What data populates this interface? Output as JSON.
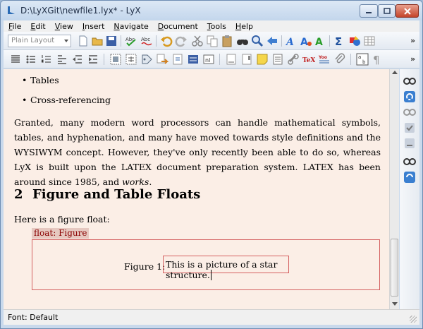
{
  "window": {
    "title": "D:\\LyXGit\\newfile1.lyx* - LyX"
  },
  "menu": [
    {
      "label": "File",
      "u": "F",
      "rest": "ile"
    },
    {
      "label": "Edit",
      "u": "E",
      "rest": "dit"
    },
    {
      "label": "View",
      "u": "V",
      "rest": "iew"
    },
    {
      "label": "Insert",
      "u": "I",
      "rest": "nsert"
    },
    {
      "label": "Navigate",
      "u": "N",
      "rest": "avigate"
    },
    {
      "label": "Document",
      "u": "D",
      "rest": "ocument"
    },
    {
      "label": "Tools",
      "u": "T",
      "rest": "ools"
    },
    {
      "label": "Help",
      "u": "H",
      "rest": "elp"
    }
  ],
  "toolbar": {
    "layout_value": "Plain Layout",
    "more": "»"
  },
  "document": {
    "bullets": [
      "Tables",
      "Cross-referencing"
    ],
    "para1": "Granted, many modern word processors can handle mathematical symbols, tables, and hyphenation, and many have moved towards style definitions and the WYSIWYM concept. However, they've only recently been able to do so, whereas LyX is built upon the LATEX document preparation system. LATEX has been around since 1985, and",
    "para1_emph": "works",
    "para1_end": ".",
    "heading_num": "2",
    "heading_text": "Figure and Table Floats",
    "float_intro": "Here is a figure float:",
    "float_label": "float: Figure",
    "fig_label": "Figure 1:",
    "caption": "This is a picture of a star structure."
  },
  "status": {
    "text": "Font: Default"
  },
  "colors": {
    "doc_bg": "#fbeee6",
    "float_border": "#d46060",
    "float_label_bg": "#e6c8c0",
    "float_label_text": "#8a0000"
  }
}
